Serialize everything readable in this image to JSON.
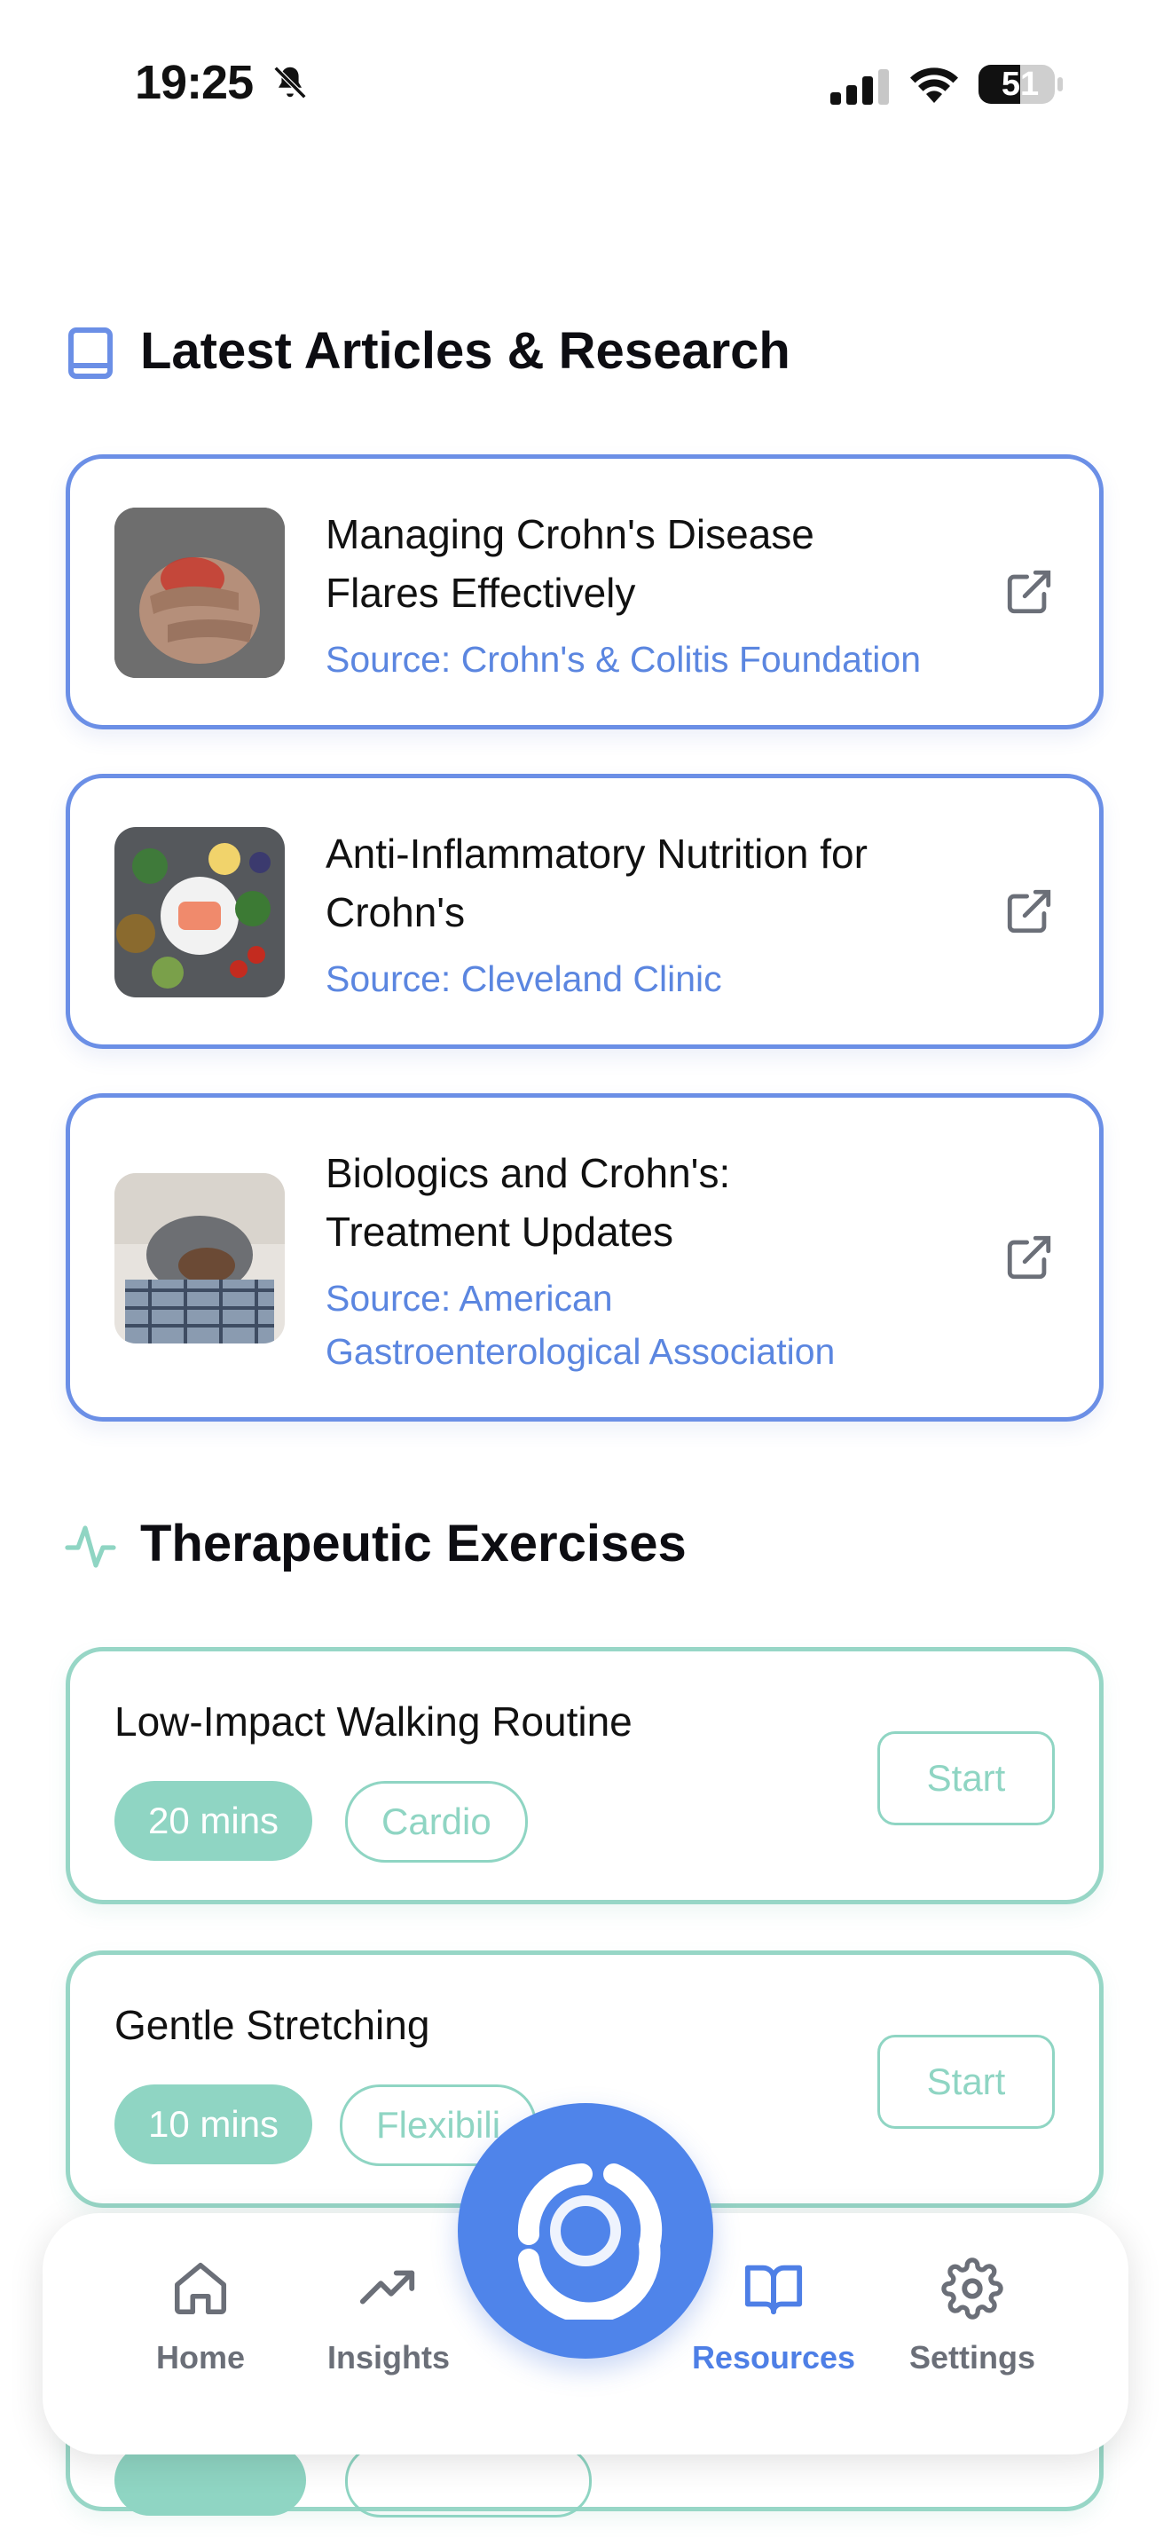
{
  "status_bar": {
    "time": "19:25",
    "battery": "51"
  },
  "articles_section": {
    "title": "Latest Articles & Research",
    "icon": "book-icon",
    "accent_color": "#6b8fe6",
    "items": [
      {
        "title_lines": [
          "Managing Crohn's Disease",
          "Flares Effectively"
        ],
        "source_lines": [
          "Source: Crohn's & Colitis Foundation"
        ]
      },
      {
        "title_lines": [
          "Anti-Inflammatory Nutrition for",
          "Crohn's"
        ],
        "source_lines": [
          "Source: Cleveland Clinic"
        ]
      },
      {
        "title_lines": [
          "Biologics and Crohn's:",
          "Treatment Updates"
        ],
        "source_lines": [
          "Source: American",
          "Gastroenterological Association"
        ]
      }
    ]
  },
  "exercises_section": {
    "title": "Therapeutic Exercises",
    "icon": "activity-icon",
    "accent_color": "#8fd5c3",
    "items": [
      {
        "title": "Low-Impact Walking Routine",
        "duration": "20 mins",
        "category": "Cardio",
        "action": "Start"
      },
      {
        "title": "Gentle Stretching",
        "duration": "10 mins",
        "category": "Flexibili",
        "action": "Start"
      }
    ]
  },
  "bottom_nav": {
    "items": [
      {
        "label": "Home",
        "icon": "home-icon"
      },
      {
        "label": "Insights",
        "icon": "trend-icon"
      },
      {
        "label": "Resources",
        "icon": "open-book-icon",
        "active": true
      },
      {
        "label": "Settings",
        "icon": "gear-icon"
      }
    ],
    "active_color": "#4e7fe6",
    "fab_color": "#4f84ea"
  }
}
